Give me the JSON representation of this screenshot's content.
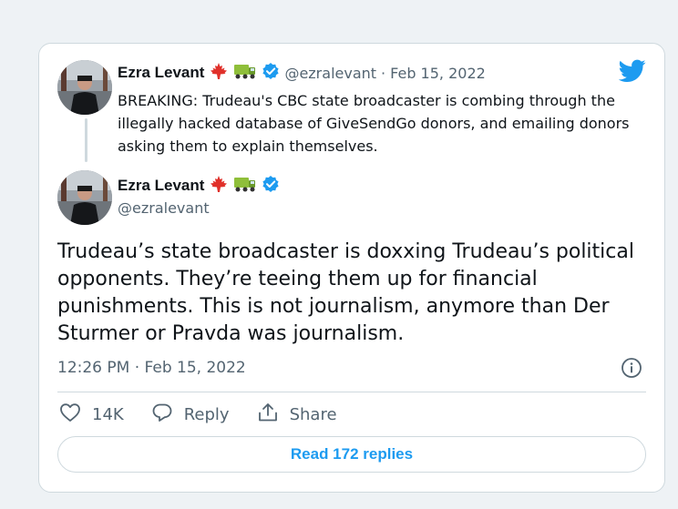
{
  "colors": {
    "accent": "#1d9bf0",
    "text": "#0f1419",
    "muted": "#536471",
    "border": "#cfd9de",
    "page_bg": "#eef2f5"
  },
  "quoted_tweet": {
    "author_name": "Ezra Levant",
    "handle": "@ezralevant",
    "separator": "·",
    "date": "Feb 15, 2022",
    "text": "BREAKING: Trudeau's CBC state broadcaster is combing through the illegally hacked database of GiveSendGo donors, and emailing donors asking them to explain themselves.",
    "icons": [
      "maple-leaf-icon",
      "truck-icon",
      "verified-badge-icon"
    ]
  },
  "main_tweet": {
    "author_name": "Ezra Levant",
    "handle": "@ezralevant",
    "text": "Trudeau’s state broadcaster is doxxing Trudeau’s political opponents. They’re teeing them up for financial punishments. This is not journalism, anymore than Der Sturmer or Pravda was journalism.",
    "timestamp": "12:26 PM · Feb 15, 2022",
    "icons": [
      "maple-leaf-icon",
      "truck-icon",
      "verified-badge-icon"
    ]
  },
  "actions": {
    "like_count": "14K",
    "reply_label": "Reply",
    "share_label": "Share"
  },
  "read_replies_label": "Read 172 replies"
}
